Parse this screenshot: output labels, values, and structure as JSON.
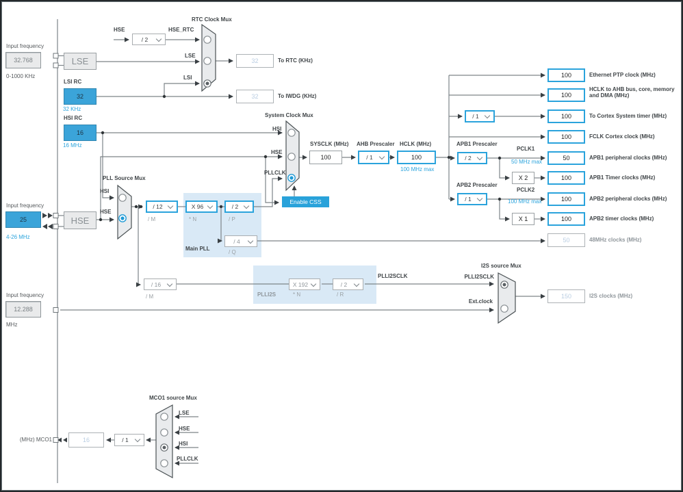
{
  "left": {
    "lse_input_label": "Input frequency",
    "lse_value": "32.768",
    "lse_range": "0-1000 KHz",
    "hse_input_label": "Input frequency",
    "hse_value": "25",
    "hse_range": "4-26 MHz",
    "i2s_input_label": "Input frequency",
    "i2s_value": "12.288",
    "i2s_range": "MHz",
    "mco_label": "(MHz) MCO1"
  },
  "sources": {
    "lse": "LSE",
    "hse": "HSE",
    "lsi_title": "LSI RC",
    "lsi_value": "32",
    "lsi_sub": "32 KHz",
    "hsi_title": "HSI RC",
    "hsi_value": "16",
    "hsi_sub": "16 MHz"
  },
  "rtc": {
    "title": "RTC Clock Mux",
    "hse": "HSE",
    "hse_div": "/ 2",
    "hse_rtc": "HSE_RTC",
    "lse": "LSE",
    "lsi": "LSI",
    "rtc_value": "32",
    "rtc_label": "To RTC (KHz)",
    "iwdg_value": "32",
    "iwdg_label": "To IWDG (KHz)"
  },
  "pllmux": {
    "title": "PLL  Source Mux",
    "hsi": "HSI",
    "hse": "HSE"
  },
  "mainpll": {
    "title": "Main PLL",
    "m": "/ 12",
    "m_sub": "/ M",
    "n": "X 96",
    "n_sub": "* N",
    "p": "/ 2",
    "p_sub": "/ P",
    "q": "/ 4",
    "q_sub": "/ Q"
  },
  "sysmux": {
    "title": "System Clock Mux",
    "hsi": "HSI",
    "hse": "HSE",
    "pllclk": "PLLCLK",
    "css": "Enable CSS"
  },
  "system": {
    "sysclk_label": "SYSCLK (MHz)",
    "sysclk": "100",
    "ahb_label": "AHB Prescaler",
    "ahb": "/ 1",
    "hclk_label": "HCLK (MHz)",
    "hclk": "100",
    "hclk_max": "100 MHz max"
  },
  "cortex": {
    "div": "/ 1"
  },
  "apb1": {
    "label": "APB1 Prescaler",
    "div": "/ 2",
    "pclk": "PCLK1",
    "max": "50 MHz max",
    "mult": "X 2"
  },
  "apb2": {
    "label": "APB2 Prescaler",
    "div": "/ 1",
    "pclk": "PCLK2",
    "max": "100 MHz max",
    "mult": "X 1"
  },
  "outputs": [
    {
      "value": "100",
      "label": "Ethernet PTP clock (MHz)"
    },
    {
      "value": "100",
      "label": "HCLK to AHB bus, core, memory and DMA (MHz)"
    },
    {
      "value": "100",
      "label": "To Cortex System timer (MHz)"
    },
    {
      "value": "100",
      "label": "FCLK Cortex clock (MHz)"
    },
    {
      "value": "50",
      "label": "APB1 peripheral clocks (MHz)"
    },
    {
      "value": "100",
      "label": "APB1 Timer clocks (MHz)"
    },
    {
      "value": "100",
      "label": "APB2 peripheral clocks (MHz)"
    },
    {
      "value": "100",
      "label": "APB2 timer clocks (MHz)"
    },
    {
      "value": "50",
      "label": "48MHz clocks (MHz)"
    },
    {
      "value": "150",
      "label": "I2S clocks (MHz)"
    }
  ],
  "plli2s": {
    "title": "PLLI2S",
    "m": "/ 16",
    "m_sub": "/ M",
    "n": "X 192",
    "n_sub": "* N",
    "r": "/ 2",
    "r_sub": "/ R",
    "out": "PLLI2SCLK"
  },
  "i2smux": {
    "title": "I2S source Mux",
    "in1": "PLLI2SCLK",
    "in2": "Ext.clock"
  },
  "mco": {
    "title": "MCO1 source Mux",
    "in1": "LSE",
    "in2": "HSE",
    "in3": "HSI",
    "in4": "PLLCLK",
    "div": "/ 1",
    "value": "16"
  },
  "colors": {
    "accent": "#2aa3dc",
    "source_fill": "#3ba4d9",
    "panel": "#d9e9f6",
    "inactive_text": "#b9cde2"
  }
}
